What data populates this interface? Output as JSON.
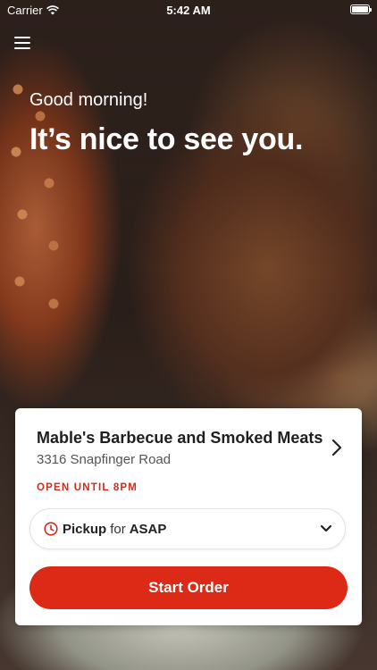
{
  "status_bar": {
    "carrier": "Carrier",
    "time": "5:42 AM"
  },
  "header": {
    "greeting": "Good morning!",
    "headline": "It’s nice to see you."
  },
  "store": {
    "name": "Mable's Barbecue and Smoked Meats",
    "address": "3316 Snapfinger Road",
    "open_status": "OPEN UNTIL 8PM"
  },
  "order": {
    "mode": "Pickup",
    "for_word": "for",
    "time_value": "ASAP",
    "start_label": "Start Order"
  },
  "icons": {
    "menu": "hamburger-menu-icon",
    "wifi": "wifi-icon",
    "battery": "battery-icon",
    "store_chevron": "chevron-right-icon",
    "clock": "clock-icon",
    "dropdown": "chevron-down-icon"
  },
  "colors": {
    "accent": "#dc2a16",
    "open_status": "#d22b1b"
  }
}
